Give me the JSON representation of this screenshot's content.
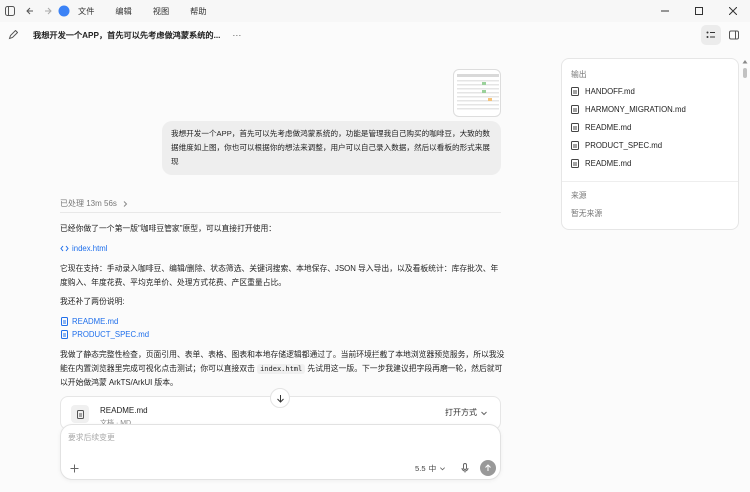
{
  "menu": [
    "文件",
    "编辑",
    "视图",
    "帮助"
  ],
  "header": {
    "title": "我想开发一个APP，首先可以先考虑做鸿蒙系统的...",
    "more": "···"
  },
  "user_message": "我想开发一个APP，首先可以先考虑做鸿蒙系统的，功能是管理我自己购买的咖啡豆，大致的数据维度如上图，你也可以根据你的想法来调整，用户可以自己录入数据，然后以看板的形式来展现",
  "processed": "已处理 13m 56s",
  "assistant": {
    "p1": "已经你做了一个第一版\"咖啡豆管家\"原型，可以直接打开使用：",
    "link_index": "index.html",
    "p2": "它现在支持：手动录入咖啡豆、编辑/删除、状态筛选、关键词搜索、本地保存、JSON 导入导出，以及看板统计：库存批次、年度购入、年度花费、平均克单价、处理方式花费、产区重量占比。",
    "p3": "我还补了两份说明:",
    "link_readme": "README.md",
    "link_spec": "PRODUCT_SPEC.md",
    "p4a": "我做了静态完整性检查，页面引用、表单、表格、图表和本地存储逻辑都通过了。当前环境拦截了本地浏览器预览服务，所以我没能在内置浏览器里完成可视化点击测试；你可以直接双击",
    "p4_code": "index.html",
    "p4b": "先试用这一版。下一步我建议把字段再磨一轮，然后就可以开始做鸿蒙 ArkTS/ArkUI 版本。"
  },
  "file_card": {
    "name": "README.md",
    "type": "文档 · MD",
    "open_label": "打开方式"
  },
  "composer": {
    "placeholder": "要求后续变更",
    "model": "5.5",
    "level": "中"
  },
  "side": {
    "output_title": "输出",
    "outputs": [
      "HANDOFF.md",
      "HARMONY_MIGRATION.md",
      "README.md",
      "PRODUCT_SPEC.md",
      "README.md"
    ],
    "source_title": "来源",
    "no_source": "暂无来源"
  },
  "colors": {
    "link": "#1f6feb",
    "accent": "#3b82f6"
  }
}
